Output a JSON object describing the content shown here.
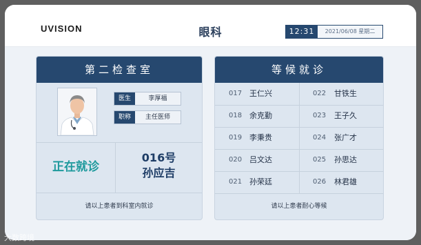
{
  "header": {
    "logo": "UVISION",
    "title": "眼科",
    "time": "12:31",
    "date": "2021/06/08  星期二"
  },
  "left_panel": {
    "room": "第二检查室",
    "doctor": [
      {
        "key": "医生",
        "value": "李厚福"
      },
      {
        "key": "职称",
        "value": "主任医师"
      }
    ],
    "status": "正在就诊",
    "current_number": "016号",
    "current_name": "孙应吉",
    "footer": "请以上患者到科室内就诊"
  },
  "right_panel": {
    "title": "等候就诊",
    "queue": [
      {
        "num": "017",
        "name": "王仁兴"
      },
      {
        "num": "022",
        "name": "甘铁生"
      },
      {
        "num": "018",
        "name": "余克勤"
      },
      {
        "num": "023",
        "name": "王子久"
      },
      {
        "num": "019",
        "name": "李秉贵"
      },
      {
        "num": "024",
        "name": "张广才"
      },
      {
        "num": "020",
        "name": "吕文达"
      },
      {
        "num": "025",
        "name": "孙思达"
      },
      {
        "num": "021",
        "name": "孙荣廷"
      },
      {
        "num": "026",
        "name": "林君雄"
      }
    ],
    "footer": "请以上患者耐心等候"
  },
  "watermark": "大数跨境"
}
